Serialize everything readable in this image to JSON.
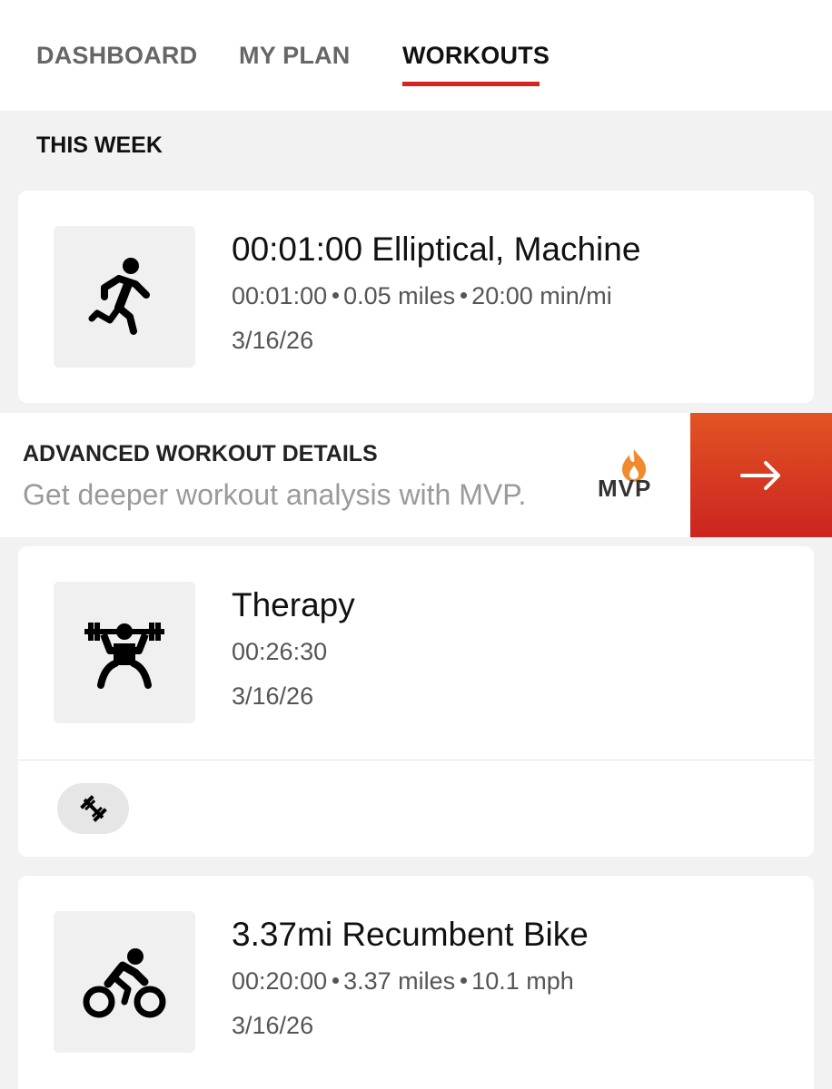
{
  "tabs": [
    {
      "label": "DASHBOARD",
      "active": false
    },
    {
      "label": "MY PLAN",
      "active": false
    },
    {
      "label": "WORKOUTS",
      "active": true
    }
  ],
  "section_title": "THIS WEEK",
  "workouts": [
    {
      "icon": "running-person-icon",
      "title": "00:01:00 Elliptical, Machine",
      "stats": [
        "00:01:00",
        "0.05 miles",
        "20:00 min/mi"
      ],
      "date": "3/16/26"
    },
    {
      "icon": "weightlifter-icon",
      "title": "Therapy",
      "stats": [
        "00:26:30"
      ],
      "date": "3/16/26",
      "tag_icon": "dumbbell-icon"
    },
    {
      "icon": "cyclist-icon",
      "title": "3.37mi Recumbent Bike",
      "stats": [
        "00:20:00",
        "3.37 miles",
        "10.1 mph"
      ],
      "date": "3/16/26"
    }
  ],
  "promo": {
    "title": "ADVANCED WORKOUT DETAILS",
    "subtitle": "Get deeper workout analysis with MVP.",
    "logo_text": "MVP",
    "arrow_icon": "arrow-right-icon"
  },
  "colors": {
    "accent": "#d7231f",
    "promo_gradient_top": "#e25424",
    "promo_gradient_bottom": "#cc2420",
    "logo_flame": "#f08a2c"
  }
}
